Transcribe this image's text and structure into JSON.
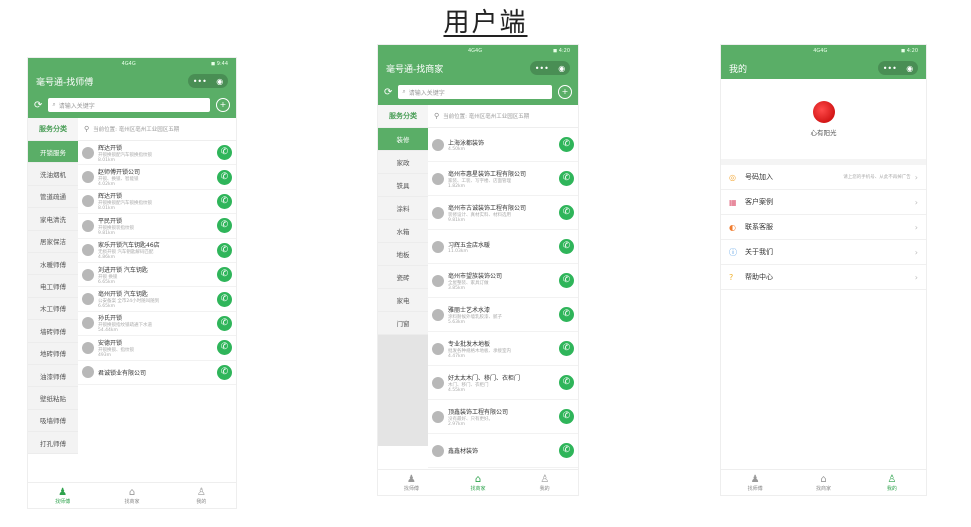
{
  "page_title": "用户端",
  "colors": {
    "primary_green": "#5aae67",
    "call_green": "#2fb55a"
  },
  "phone1": {
    "status_left": "4G4G",
    "status_right": "◼ 9:44",
    "title": "毫号通-找师傅",
    "search_placeholder": "请输入关键字",
    "category_header": "服务分类",
    "location": "当前位置: 亳州区亳州工业园区五期",
    "categories": [
      "开锁服务",
      "洗油烟机",
      "管道疏通",
      "家电清洗",
      "居家保洁",
      "水暖师傅",
      "电工师傅",
      "木工师傅",
      "墙砖师傅",
      "地砖师傅",
      "油漆师傅",
      "壁纸粘贴",
      "吸墙师傅",
      "打孔师傅"
    ],
    "items": [
      {
        "name": "辉达开锁",
        "desc": "开锁换锁配汽车锁换指纹锁",
        "dist": "8.01km"
      },
      {
        "name": "赵师傅开锁公司",
        "desc": "开锁、换锁、智能锁",
        "dist": "4.02km"
      },
      {
        "name": "辉达开锁",
        "desc": "开锁换锁配汽车锁换指纹锁",
        "dist": "8.01km"
      },
      {
        "name": "平民开锁",
        "desc": "开锁换锁装指纹锁",
        "dist": "9.81km"
      },
      {
        "name": "家乐开锁汽车钥匙46店",
        "desc": "无损开锁 汽车钥匙解码匹配",
        "dist": "4.86km"
      },
      {
        "name": "刘进开锁 汽车钥匙",
        "desc": "开锁 换锁",
        "dist": "6.65km"
      },
      {
        "name": "亳州开锁 汽车钥匙",
        "desc": "公安备案 全市24小时随叫随到",
        "dist": "6.65km"
      },
      {
        "name": "孙氏开锁",
        "desc": "开锁换锁指纹锁疏通下水道",
        "dist": "54.44km"
      },
      {
        "name": "安德开锁",
        "desc": "开锁换锁、指纹锁",
        "dist": "493m"
      },
      {
        "name": "君诚锁业有限公司",
        "desc": "",
        "dist": ""
      }
    ],
    "tabs": [
      "找师傅",
      "找商家",
      "我的"
    ]
  },
  "phone2": {
    "status_left": "4G4G",
    "status_right": "◼ 4:20",
    "title": "毫号通-找商家",
    "search_placeholder": "请输入关键字",
    "category_header": "服务分类",
    "location": "当前位置: 亳州区亳州工业园区五期",
    "categories": [
      "装修",
      "家政",
      "铁具",
      "涂料",
      "水箱",
      "地板",
      "瓷砖",
      "家电",
      "门窗"
    ],
    "items": [
      {
        "name": "上海泳都装饰",
        "desc": "",
        "dist": "4.50km"
      },
      {
        "name": "亳州市惠星装饰工程有限公司",
        "desc": "家装、工装、写字楼、店面管理",
        "dist": "1.82km"
      },
      {
        "name": "亳州市古诚装饰工程有限公司",
        "desc": "装修设计、真材实料、材料选用",
        "dist": "9.81km"
      },
      {
        "name": "习辉五金店水暖",
        "desc": "",
        "dist": "11.03km"
      },
      {
        "name": "亳州市望族装饰公司",
        "desc": "全屋整装、家具订做",
        "dist": "3.85km"
      },
      {
        "name": "雅丽士艺术水漆",
        "desc": "涂料耐候外墙乳胶漆、腻子",
        "dist": "5.63km"
      },
      {
        "name": "专业批发木地板",
        "desc": "批发各种规格木地板、承接室内",
        "dist": "4.47km"
      },
      {
        "name": "好太太木门、移门、衣柜门",
        "desc": "木门、移门、衣柜门",
        "dist": "4.55km"
      },
      {
        "name": "顶鑫装饰工程有限公司",
        "desc": "没有最好、只有更好。",
        "dist": "2.97km"
      },
      {
        "name": "鑫鑫材装饰",
        "desc": "",
        "dist": ""
      }
    ],
    "tabs": [
      "找师傅",
      "找商家",
      "我的"
    ]
  },
  "phone3": {
    "status_left": "4G4G",
    "status_right": "◼ 4:20",
    "title": "我的",
    "nickname": "心有阳光",
    "menu": [
      {
        "label": "号码加入",
        "hint": "请上您的手机号、从此不再掉广告"
      },
      {
        "label": "客户案例",
        "hint": ""
      },
      {
        "label": "联系客服",
        "hint": ""
      },
      {
        "label": "关于我们",
        "hint": ""
      },
      {
        "label": "帮助中心",
        "hint": ""
      }
    ],
    "tabs": [
      "找师傅",
      "找商家",
      "我的"
    ]
  }
}
